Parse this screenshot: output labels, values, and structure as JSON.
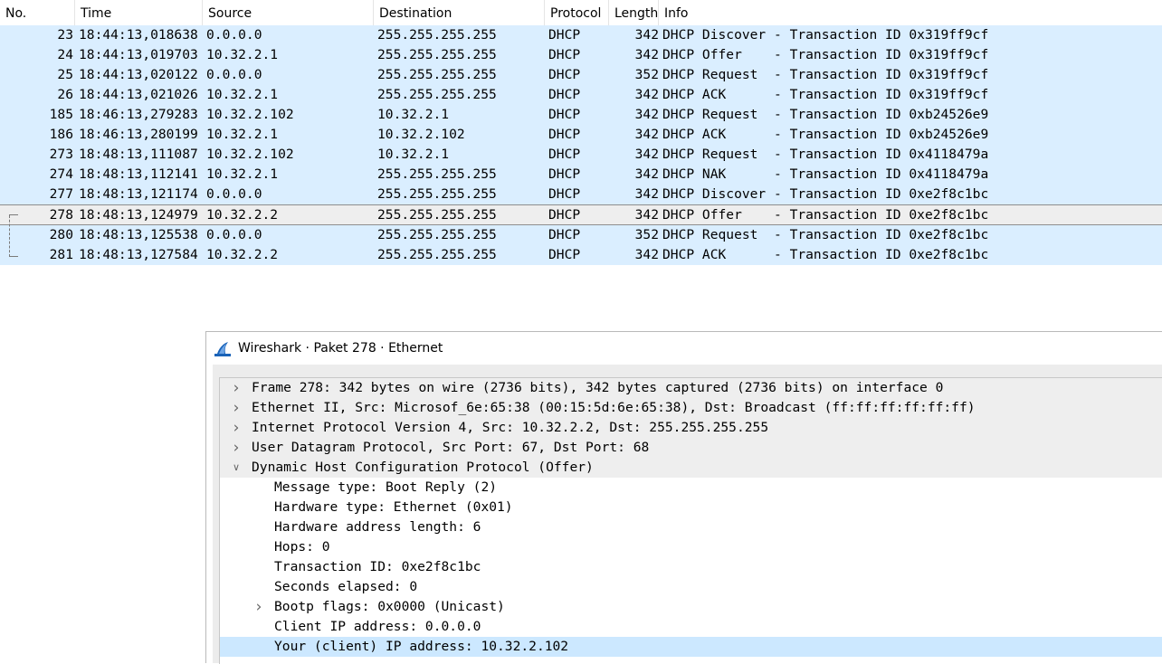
{
  "packet_list": {
    "columns": [
      "No.",
      "Time",
      "Source",
      "Destination",
      "Protocol",
      "Length",
      "Info"
    ],
    "rows": [
      {
        "no": "23",
        "time": "18:44:13,018638",
        "src": "0.0.0.0",
        "dst": "255.255.255.255",
        "proto": "DHCP",
        "len": "342",
        "info": "DHCP Discover - Transaction ID 0x319ff9cf"
      },
      {
        "no": "24",
        "time": "18:44:13,019703",
        "src": "10.32.2.1",
        "dst": "255.255.255.255",
        "proto": "DHCP",
        "len": "342",
        "info": "DHCP Offer    - Transaction ID 0x319ff9cf"
      },
      {
        "no": "25",
        "time": "18:44:13,020122",
        "src": "0.0.0.0",
        "dst": "255.255.255.255",
        "proto": "DHCP",
        "len": "352",
        "info": "DHCP Request  - Transaction ID 0x319ff9cf"
      },
      {
        "no": "26",
        "time": "18:44:13,021026",
        "src": "10.32.2.1",
        "dst": "255.255.255.255",
        "proto": "DHCP",
        "len": "342",
        "info": "DHCP ACK      - Transaction ID 0x319ff9cf"
      },
      {
        "no": "185",
        "time": "18:46:13,279283",
        "src": "10.32.2.102",
        "dst": "10.32.2.1",
        "proto": "DHCP",
        "len": "342",
        "info": "DHCP Request  - Transaction ID 0xb24526e9"
      },
      {
        "no": "186",
        "time": "18:46:13,280199",
        "src": "10.32.2.1",
        "dst": "10.32.2.102",
        "proto": "DHCP",
        "len": "342",
        "info": "DHCP ACK      - Transaction ID 0xb24526e9"
      },
      {
        "no": "273",
        "time": "18:48:13,111087",
        "src": "10.32.2.102",
        "dst": "10.32.2.1",
        "proto": "DHCP",
        "len": "342",
        "info": "DHCP Request  - Transaction ID 0x4118479a"
      },
      {
        "no": "274",
        "time": "18:48:13,112141",
        "src": "10.32.2.1",
        "dst": "255.255.255.255",
        "proto": "DHCP",
        "len": "342",
        "info": "DHCP NAK      - Transaction ID 0x4118479a"
      },
      {
        "no": "277",
        "time": "18:48:13,121174",
        "src": "0.0.0.0",
        "dst": "255.255.255.255",
        "proto": "DHCP",
        "len": "342",
        "info": "DHCP Discover - Transaction ID 0xe2f8c1bc"
      },
      {
        "no": "278",
        "time": "18:48:13,124979",
        "src": "10.32.2.2",
        "dst": "255.255.255.255",
        "proto": "DHCP",
        "len": "342",
        "info": "DHCP Offer    - Transaction ID 0xe2f8c1bc",
        "selected": true
      },
      {
        "no": "280",
        "time": "18:48:13,125538",
        "src": "0.0.0.0",
        "dst": "255.255.255.255",
        "proto": "DHCP",
        "len": "352",
        "info": "DHCP Request  - Transaction ID 0xe2f8c1bc"
      },
      {
        "no": "281",
        "time": "18:48:13,127584",
        "src": "10.32.2.2",
        "dst": "255.255.255.255",
        "proto": "DHCP",
        "len": "342",
        "info": "DHCP ACK      - Transaction ID 0xe2f8c1bc"
      }
    ]
  },
  "packet_window": {
    "icon": "wireshark-fin-icon",
    "title": "Wireshark · Paket 278 · Ethernet",
    "tree": [
      {
        "text": "Frame 278: 342 bytes on wire (2736 bits), 342 bytes captured (2736 bits) on interface 0",
        "level": 0,
        "expander": "collapsed"
      },
      {
        "text": "Ethernet II, Src: Microsof_6e:65:38 (00:15:5d:6e:65:38), Dst: Broadcast (ff:ff:ff:ff:ff:ff)",
        "level": 0,
        "expander": "collapsed"
      },
      {
        "text": "Internet Protocol Version 4, Src: 10.32.2.2, Dst: 255.255.255.255",
        "level": 0,
        "expander": "collapsed"
      },
      {
        "text": "User Datagram Protocol, Src Port: 67, Dst Port: 68",
        "level": 0,
        "expander": "collapsed"
      },
      {
        "text": "Dynamic Host Configuration Protocol (Offer)",
        "level": 0,
        "expander": "expanded"
      },
      {
        "text": "Message type: Boot Reply (2)",
        "level": 1,
        "expander": "none"
      },
      {
        "text": "Hardware type: Ethernet (0x01)",
        "level": 1,
        "expander": "none"
      },
      {
        "text": "Hardware address length: 6",
        "level": 1,
        "expander": "none"
      },
      {
        "text": "Hops: 0",
        "level": 1,
        "expander": "none"
      },
      {
        "text": "Transaction ID: 0xe2f8c1bc",
        "level": 1,
        "expander": "none"
      },
      {
        "text": "Seconds elapsed: 0",
        "level": 1,
        "expander": "none"
      },
      {
        "text": "Bootp flags: 0x0000 (Unicast)",
        "level": 1,
        "expander": "collapsed"
      },
      {
        "text": "Client IP address: 0.0.0.0",
        "level": 1,
        "expander": "none"
      },
      {
        "text": "Your (client) IP address: 10.32.2.102",
        "level": 1,
        "expander": "none",
        "highlighted": true
      }
    ]
  },
  "colors": {
    "row_bg": "#daeeff",
    "selected_row_bg": "#eeeeee",
    "highlight_bg": "#cce8ff",
    "fin_icon_blue": "#1a63b8"
  }
}
